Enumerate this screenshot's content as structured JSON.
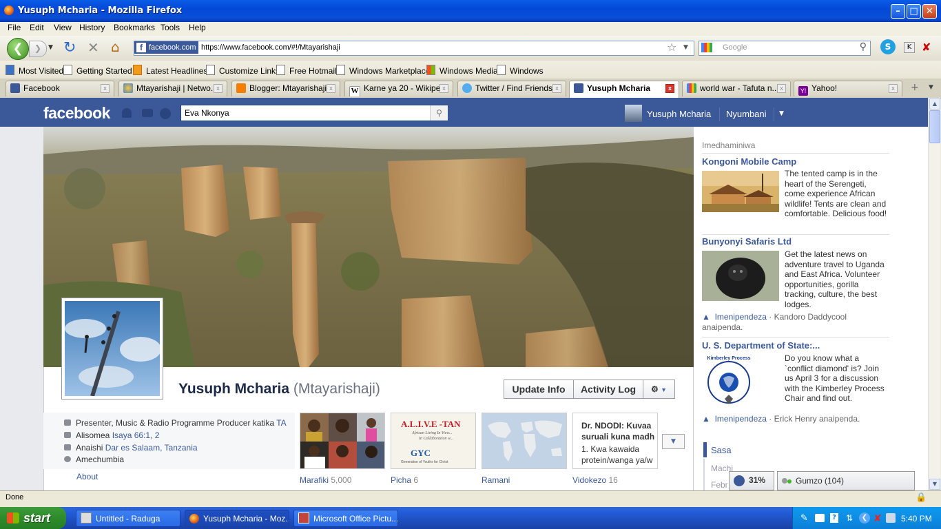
{
  "window": {
    "title": "Yusuph Mcharia - Mozilla Firefox"
  },
  "menu": [
    "File",
    "Edit",
    "View",
    "History",
    "Bookmarks",
    "Tools",
    "Help"
  ],
  "nav": {
    "site_badge": "facebook.com",
    "url": "https://www.facebook.com/#!/Mtayarishaji",
    "search_placeholder": "Google"
  },
  "bookmarks": [
    "Most Visited",
    "Getting Started",
    "Latest Headlines",
    "Customize Links",
    "Free Hotmail",
    "Windows Marketplace",
    "Windows Media",
    "Windows"
  ],
  "tabs": [
    {
      "label": "Facebook"
    },
    {
      "label": "Mtayarishaji | Netwo..."
    },
    {
      "label": "Blogger: Mtayarishaji..."
    },
    {
      "label": "Karne ya 20 - Wikipe..."
    },
    {
      "label": "Twitter / Find Friends"
    },
    {
      "label": "Yusuph Mcharia"
    },
    {
      "label": "world war - Tafuta n..."
    },
    {
      "label": "Yahoo!"
    }
  ],
  "fb": {
    "logo": "facebook",
    "search_value": "Eva Nkonya",
    "user_name": "Yusuph Mcharia",
    "home_link": "Nyumbani"
  },
  "profile": {
    "name": "Yusuph Mcharia",
    "alias": "(Mtayarishaji)",
    "update_info": "Update Info",
    "activity_log": "Activity Log",
    "info": {
      "work_prefix": "Presenter, Music & Radio Programme Producer katika ",
      "work_link": "TA",
      "studied_prefix": "Alisomea ",
      "studied_link": "Isaya 66:1, 2",
      "lives_prefix": "Anaishi ",
      "lives_link": "Dar es Salaam, Tanzania",
      "relationship": "Amechumbia"
    },
    "about": "About",
    "tiles": [
      {
        "label": "Marafiki",
        "count": "5,000"
      },
      {
        "label": "Picha",
        "count": "6"
      },
      {
        "label": "Ramani",
        "count": ""
      },
      {
        "label": "Vidokezo",
        "count": "16"
      }
    ],
    "photo_tile_text": "A.L.I.V.E -TAN",
    "photo_tile_sub": "African Living In View...",
    "photo_tile_sub2": "In Collaboration w...",
    "photo_tile_gyc": "GYC",
    "photo_tile_gyc_sub": "Generation of Youths for Christ",
    "note_tile_text": "Dr. NDODI: Kuvaa suruali kuna madh",
    "note_tile_text2": "1. Kwa kawaida protein/wanga ya/w"
  },
  "sidebar": {
    "sponsored": "Imedhaminiwa",
    "ads": [
      {
        "title": "Kongoni Mobile Camp",
        "text": "The tented camp is in the heart of the Serengeti, come experience African wildlife! Tents are clean and comfortable. Delicious food!"
      },
      {
        "title": "Bunyonyi Safaris Ltd",
        "text": "Get the latest news on adventure travel to Uganda and East Africa. Volunteer opportunities, gorilla tracking, culture, the best lodges.",
        "like_link": "Imenipendeza",
        "like_rest": " · Kandoro Daddycool anaipenda."
      },
      {
        "title": "U. S. Department of State:...",
        "text": "Do you know what a `conflict diamond' is? Join us April 3 for a discussion with the Kimberley Process Chair and find out.",
        "like_link": "Imenipendeza",
        "like_rest": " · Erick Henry anaipenda."
      }
    ],
    "kimberley_logo_text": "Kimberley Process",
    "timeline_now": "Sasa",
    "timeline_m1": "Machi",
    "timeline_m2": "Febr",
    "chat_pct": "31%",
    "chat_label": "Gumzo (104)"
  },
  "status": {
    "text": "Done"
  },
  "taskbar": {
    "start": "start",
    "items": [
      "Untitled - Raduga",
      "Yusuph Mcharia - Moz...",
      "Microsoft Office Pictu..."
    ],
    "clock": "5:40 PM"
  },
  "colors": {
    "fb_blue": "#3b5998",
    "xp_blue": "#245edb",
    "start_green": "#2e8b2b"
  }
}
